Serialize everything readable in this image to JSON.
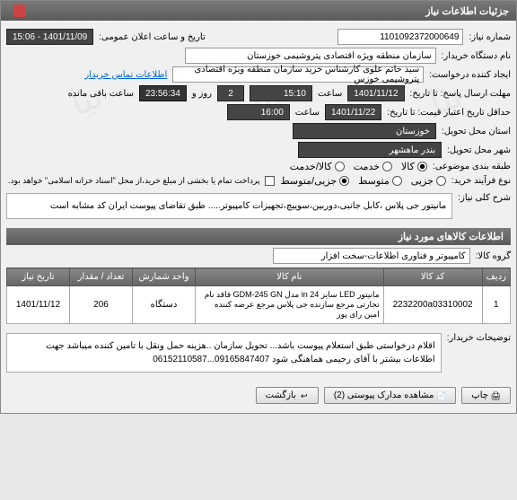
{
  "window": {
    "title": "جزئیات اطلاعات نیاز"
  },
  "fields": {
    "need_no_label": "شماره نیاز",
    "need_no": "1101092372000649",
    "announce_label": "تاریخ و ساعت اعلان عمومی",
    "announce_value": "1401/11/09 - 15:06",
    "buyer_org_label": "نام دستگاه خریدار",
    "buyer_org": "سازمان منطقه ویژه اقتصادی پتروشیمی خوزستان",
    "creator_label": "ایجاد کننده درخواست",
    "creator": "سید حاتم علوی کارشناس خرید سازمان منطقه ویژه اقتصادی پتروشیمی خوزس",
    "contact_link": "اطلاعات تماس خریدار",
    "deadline_label": "مهلت ارسال پاسخ: تا تاریخ",
    "deadline_date": "1401/11/12",
    "time_label": "ساعت",
    "deadline_time": "15:10",
    "days_left": "2",
    "days_unit": "روز و",
    "time_left": "23:56:34",
    "time_left_unit": "ساعت باقی مانده",
    "validity_label": "حداقل تاریخ اعتبار قیمت: تا تاریخ",
    "validity_date": "1401/11/22",
    "validity_time": "16:00",
    "province_label": "استان محل تحویل",
    "province": "خوزستان",
    "city_label": "شهر محل تحویل",
    "city": "بندر ماهشهر",
    "class_label": "طبقه بندی موضوعی",
    "class_options": [
      "کالا",
      "خدمت",
      "کالا/خدمت"
    ],
    "class_selected_index": 0,
    "buy_type_label": "نوع فرآیند خرید",
    "buy_options": [
      "جزیی",
      "متوسط",
      "جزیی/متوسط"
    ],
    "buy_selected_index": 2,
    "payment_note": "پرداخت تمام یا بخشی از مبلغ خرید،از محل \"اسناد خزانه اسلامی\" خواهد بود.",
    "general_desc_label": "شرح کلی نیاز",
    "general_desc": "مانیتور جی پلاس ،کابل جانبی،دوربین،سوییچ،تجهیزات کامپیوتر..... طبق تقاضای پیوست ایران کد مشابه است"
  },
  "items_section": {
    "header": "اطلاعات کالاهای مورد نیاز",
    "group_label": "گروه کالا",
    "group": "کامپیوتر و فناوری اطلاعات-سخت افزار",
    "columns": [
      "ردیف",
      "کد کالا",
      "نام کالا",
      "واحد شمارش",
      "تعداد / مقدار",
      "تاریخ نیاز"
    ],
    "rows": [
      {
        "idx": "1",
        "code": "2232200a03310002",
        "name": "مانیتور LED سایز 24 in مدل GDM-245 GN فاقد نام تجارتی مرجع سازنده جی پلاس مرجع عرضه کننده امین رای پور",
        "unit": "دستگاه",
        "qty": "206",
        "date": "1401/11/12"
      }
    ]
  },
  "buyer_note": {
    "label": "توضیحات خریدار",
    "text": "اقلام درخواستی طبق استعلام پیوست باشد... تحویل سازمان ..هزینه حمل ونقل با تامین کننده میباشد جهت اطلاعات بیشتر با آقای رحیمی هماهنگی شود 09165847407...06152110587"
  },
  "buttons": {
    "print": "چاپ",
    "attachments": "مشاهده مدارک پیوستی (2)",
    "back": "بازگشت"
  }
}
